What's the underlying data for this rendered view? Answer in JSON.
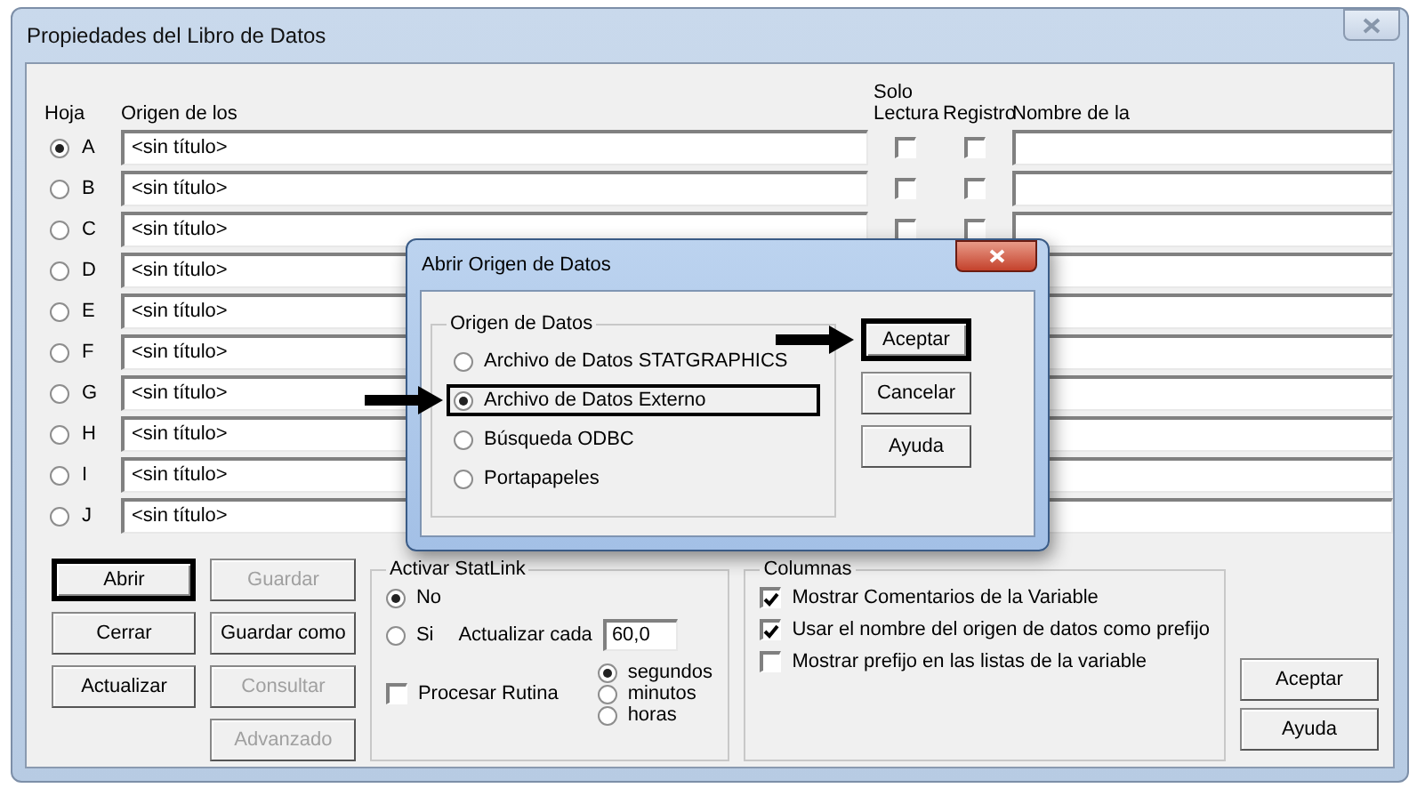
{
  "window": {
    "title": "Propiedades del Libro de Datos"
  },
  "headers": {
    "sheet": "Hoja",
    "source": "Origen de los",
    "read_only_top": "Solo",
    "read_only": "Lectura",
    "log": "Registro",
    "name": "Nombre de la"
  },
  "rows": [
    {
      "letter": "A",
      "selected": true,
      "source": "<sin título>",
      "read_only": false,
      "log": false
    },
    {
      "letter": "B",
      "selected": false,
      "source": "<sin título>",
      "read_only": false,
      "log": false
    },
    {
      "letter": "C",
      "selected": false,
      "source": "<sin título>",
      "read_only": false,
      "log": false
    },
    {
      "letter": "D",
      "selected": false,
      "source": "<sin título>"
    },
    {
      "letter": "E",
      "selected": false,
      "source": "<sin título>"
    },
    {
      "letter": "F",
      "selected": false,
      "source": "<sin título>"
    },
    {
      "letter": "G",
      "selected": false,
      "source": "<sin título>"
    },
    {
      "letter": "H",
      "selected": false,
      "source": "<sin título>"
    },
    {
      "letter": "I",
      "selected": false,
      "source": "<sin título>"
    },
    {
      "letter": "J",
      "selected": false,
      "source": "<sin título>"
    }
  ],
  "file_buttons": [
    {
      "label": "Abrir",
      "disabled": false,
      "highlighted": true
    },
    {
      "label": "Cerrar",
      "disabled": false,
      "highlighted": false
    },
    {
      "label": "Actualizar",
      "disabled": false,
      "highlighted": false
    }
  ],
  "save_buttons": [
    {
      "label": "Guardar",
      "disabled": true
    },
    {
      "label": "Guardar como",
      "disabled": false
    },
    {
      "label": "Consultar",
      "disabled": true
    },
    {
      "label": "Advanzado",
      "disabled": true
    }
  ],
  "statlink": {
    "title": "Activar StatLink",
    "modes": [
      {
        "label": "No",
        "selected": true
      },
      {
        "label": "Si",
        "selected": false
      }
    ],
    "interval_label": "Actualizar cada",
    "interval_value": "60,0",
    "routine": {
      "label": "Procesar Rutina",
      "checked": false
    },
    "units": [
      {
        "label": "segundos",
        "selected": true
      },
      {
        "label": "minutos",
        "selected": false
      },
      {
        "label": "horas",
        "selected": false
      }
    ]
  },
  "columns_group": {
    "title": "Columnas",
    "options": [
      {
        "label": "Mostrar Comentarios de la Variable",
        "checked": true
      },
      {
        "label": "Usar el nombre del origen de datos como prefijo",
        "checked": true
      },
      {
        "label": "Mostrar prefijo en las listas de la variable",
        "checked": false
      }
    ]
  },
  "main_buttons": [
    {
      "label": "Aceptar"
    },
    {
      "label": "Ayuda"
    }
  ],
  "dialog": {
    "title": "Abrir Origen de Datos",
    "group_title": "Origen de Datos",
    "options": [
      {
        "label": "Archivo de Datos STATGRAPHICS",
        "selected": false,
        "highlighted": false,
        "arrow": false
      },
      {
        "label": "Archivo de Datos Externo",
        "selected": true,
        "highlighted": true,
        "arrow": true
      },
      {
        "label": "Búsqueda ODBC",
        "selected": false,
        "highlighted": false,
        "arrow": false
      },
      {
        "label": "Portapapeles",
        "selected": false,
        "highlighted": false,
        "arrow": false
      }
    ],
    "buttons": [
      {
        "label": "Aceptar",
        "highlighted": true,
        "arrow": true
      },
      {
        "label": "Cancelar",
        "highlighted": false,
        "arrow": false
      },
      {
        "label": "Ayuda",
        "highlighted": false,
        "arrow": false
      }
    ]
  }
}
